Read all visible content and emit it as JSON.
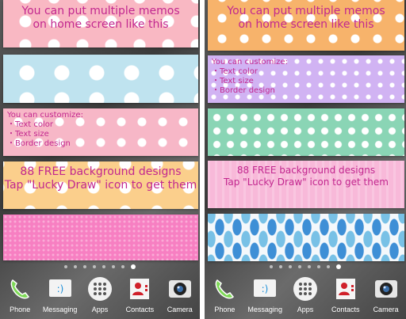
{
  "left_screen": {
    "memo1": {
      "line1": "You can put multiple memos",
      "line2": "on home screen like this"
    },
    "memo3": {
      "title": "You can customize:",
      "items": [
        "・Text color",
        "・Text size",
        "・Border design"
      ]
    },
    "memo4": {
      "line1": "88 FREE background designs",
      "line2": "Tap \"Lucky Draw\" icon to get them"
    }
  },
  "right_screen": {
    "memo1": {
      "line1": "You can put multiple memos",
      "line2": "on home screen like this"
    },
    "memo2": {
      "title": "You can customize:",
      "items": [
        "・Text color",
        "・Text size",
        "・Border design"
      ]
    },
    "memo4": {
      "line1": "88 FREE background designs",
      "line2": "Tap \"Lucky Draw\" icon to get them"
    }
  },
  "dock": {
    "items": [
      {
        "label": "Phone",
        "icon": "phone-icon"
      },
      {
        "label": "Messaging",
        "icon": "messaging-icon"
      },
      {
        "label": "Apps",
        "icon": "apps-icon"
      },
      {
        "label": "Contacts",
        "icon": "contacts-icon"
      },
      {
        "label": "Camera",
        "icon": "camera-icon"
      }
    ]
  },
  "text_color": "#c2278f",
  "page_indicator": {
    "count": 8,
    "active_index": 7
  }
}
